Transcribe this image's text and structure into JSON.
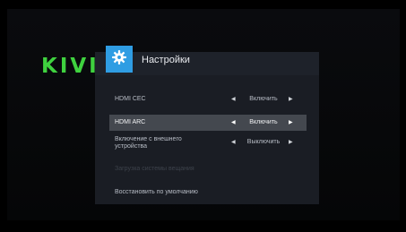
{
  "brand": {
    "logo_text": "KIVI",
    "logo_color": "#3fd23f"
  },
  "panel": {
    "title": "Настройки",
    "icon": "gear-icon",
    "accent_color": "#2f9de3"
  },
  "rows": [
    {
      "label": "HDMI CEC",
      "value": "Включить",
      "left_arrow": "◀",
      "right_arrow": "▶"
    },
    {
      "label": "HDMI ARC",
      "value": "Включить",
      "left_arrow": "◀",
      "right_arrow": "▶",
      "selected": true
    },
    {
      "label": "Включение с внешнего устройства",
      "value": "Выключить",
      "left_arrow": "◀",
      "right_arrow": "▶"
    },
    {
      "label": "Загрузка системы вещания",
      "disabled": true
    },
    {
      "label": "Восстановить по умолчанию"
    }
  ]
}
